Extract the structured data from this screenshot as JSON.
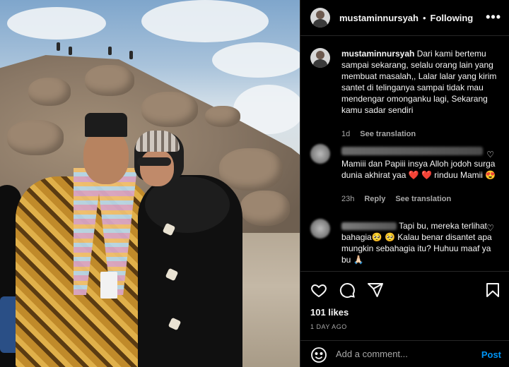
{
  "header": {
    "username": "mustaminnursyah",
    "separator": "•",
    "follow_status": "Following",
    "more_icon": "more-horizontal-icon"
  },
  "caption": {
    "username": "mustaminnursyah",
    "text": "Dari kami bertemu sampai sekarang, selalu orang lain yang membuat masalah,, Lalar lalar yang kirim santet di telinganya sampai tidak mau mendengar omonganku lagi, Sekarang kamu sadar sendiri",
    "age": "1d",
    "see_translation": "See translation"
  },
  "comments": [
    {
      "text": "Mamiii dan Papiii insya Alloh jodoh surga dunia akhirat yaa ❤️ ❤️ rinduu Mamii 😍",
      "age": "23h",
      "reply": "Reply",
      "see_translation": "See translation",
      "like_icon": "heart-outline-icon"
    },
    {
      "text": "Tapi bu, mereka terlihat bahagia🥺 🥺 Kalau benar disantet apa mungkin sebahagia itu? Huhuu maaf ya bu 🙏🏻",
      "like_icon": "heart-outline-icon"
    }
  ],
  "actions": {
    "like_icon": "heart-outline-icon",
    "comment_icon": "comment-icon",
    "share_icon": "send-icon",
    "save_icon": "bookmark-icon",
    "likes": "101 likes",
    "date": "1 DAY AGO"
  },
  "composer": {
    "emoji_icon": "smile-icon",
    "placeholder": "Add a comment...",
    "post_label": "Post"
  },
  "colors": {
    "background": "#000000",
    "text": "#f5f5f5",
    "muted": "#a8a8a8",
    "link": "#0095f6",
    "heart": "#ed4956"
  }
}
